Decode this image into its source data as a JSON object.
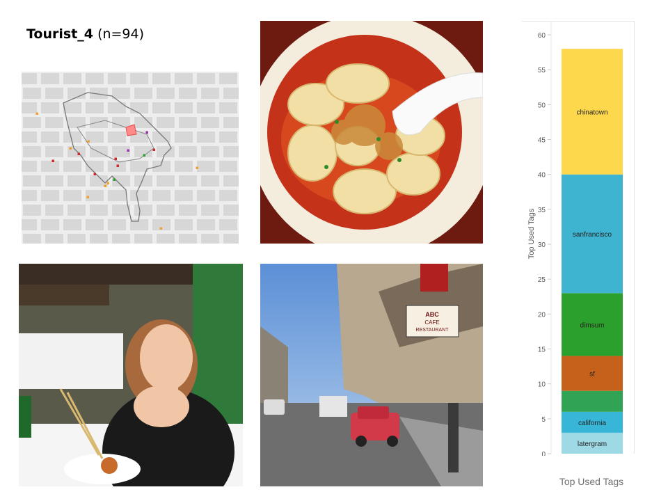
{
  "header": {
    "name": "Tourist_4",
    "count": "(n=94)"
  },
  "map": {
    "poi_colors": [
      "#f0a030",
      "#d62728",
      "#9b30b0",
      "#2ca02c"
    ]
  },
  "photos": {
    "street_sign_top": "ABC",
    "street_sign_mid": "CAFE",
    "street_sign_bottom": "RESTAURANT"
  },
  "chart_data": {
    "type": "bar",
    "stacked": true,
    "title": "Top Used Tags",
    "ylabel": "Top Used Tags",
    "xlabel": "",
    "ylim": [
      0,
      62
    ],
    "yticks": [
      0,
      5,
      10,
      15,
      20,
      25,
      30,
      35,
      40,
      45,
      50,
      55,
      60
    ],
    "grid": false,
    "segments": [
      {
        "label": "latergram",
        "start": 0,
        "end": 3,
        "color": "#9edae5"
      },
      {
        "label": "california",
        "start": 3,
        "end": 6,
        "color": "#38b6d8"
      },
      {
        "label": "",
        "start": 6,
        "end": 9,
        "color": "#31a354"
      },
      {
        "label": "sf",
        "start": 9,
        "end": 14,
        "color": "#c5611a"
      },
      {
        "label": "dimsum",
        "start": 14,
        "end": 23,
        "color": "#2ca02c"
      },
      {
        "label": "sanfrancisco",
        "start": 23,
        "end": 40,
        "color": "#3fb4d0"
      },
      {
        "label": "chinatown",
        "start": 40,
        "end": 58,
        "color": "#fdd84c"
      }
    ]
  }
}
